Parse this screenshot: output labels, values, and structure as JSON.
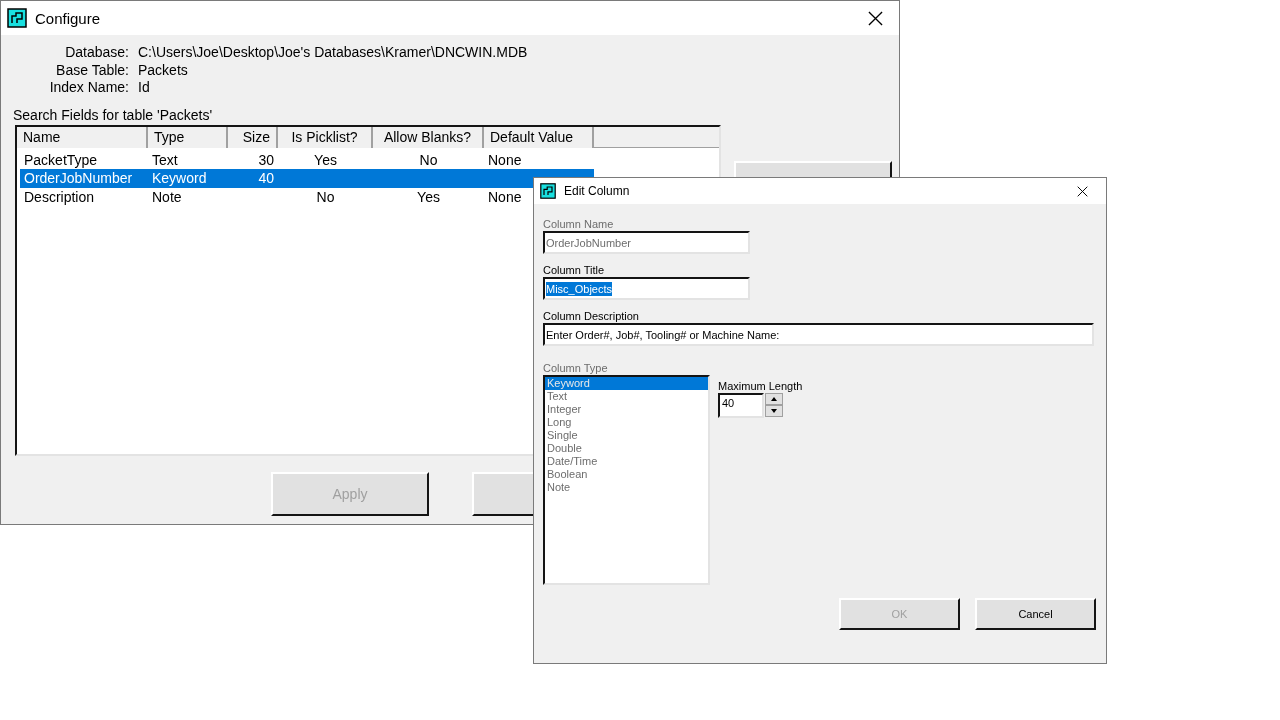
{
  "configure_window": {
    "title": "Configure",
    "info": [
      {
        "label": "Database:",
        "value": "C:\\Users\\Joe\\Desktop\\Joe's Databases\\Kramer\\DNCWIN.MDB"
      },
      {
        "label": "Base Table:",
        "value": "Packets"
      },
      {
        "label": "Index Name:",
        "value": "Id"
      }
    ],
    "search_fields_label": "Search Fields for table 'Packets'",
    "table": {
      "columns": [
        "Name",
        "Type",
        "Size",
        "Is Picklist?",
        "Allow Blanks?",
        "Default Value"
      ],
      "rows": [
        {
          "cells": [
            "PacketType",
            "Text",
            "30",
            "Yes",
            "No",
            "None"
          ],
          "selected": false
        },
        {
          "cells": [
            "OrderJobNumber",
            "Keyword",
            "40"
          ],
          "selected": true
        },
        {
          "cells": [
            "Description",
            "Note",
            null,
            "No",
            "Yes",
            "None"
          ],
          "selected": false
        }
      ]
    },
    "buttons": [
      {
        "label": "Apply",
        "disabled": true
      }
    ]
  },
  "edit_column_dialog": {
    "title": "Edit Column",
    "fields": [
      {
        "label": "Column Name",
        "value": "OrderJobNumber",
        "disabled": true,
        "text_selected": false,
        "kind": "short"
      },
      {
        "label": "Column Title",
        "value": "Misc_Objects",
        "disabled": false,
        "text_selected": true,
        "kind": "short"
      },
      {
        "label": "Column Description",
        "value": "Enter Order#, Job#, Tooling# or Machine Name:",
        "disabled": false,
        "text_selected": false,
        "kind": "wide"
      }
    ],
    "column_type": {
      "label": "Column Type",
      "disabled": true,
      "items": [
        {
          "label": "Keyword",
          "selected": true
        },
        {
          "label": "Text",
          "selected": false
        },
        {
          "label": "Integer",
          "selected": false
        },
        {
          "label": "Long",
          "selected": false
        },
        {
          "label": "Single",
          "selected": false
        },
        {
          "label": "Double",
          "selected": false
        },
        {
          "label": "Date/Time",
          "selected": false
        },
        {
          "label": "Boolean",
          "selected": false
        },
        {
          "label": "Note",
          "selected": false
        }
      ]
    },
    "maximum_length": {
      "label": "Maximum Length",
      "value": "40"
    },
    "buttons": [
      {
        "label": "OK",
        "disabled": true
      },
      {
        "label": "Cancel",
        "disabled": false
      }
    ]
  }
}
